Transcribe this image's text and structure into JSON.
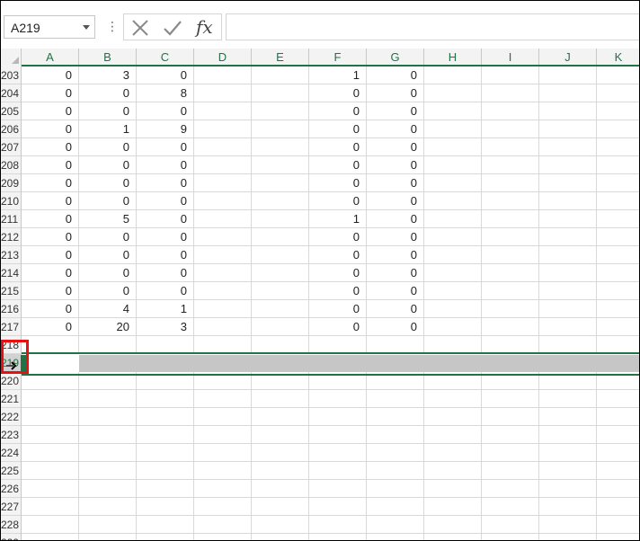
{
  "name_box": {
    "value": "A219"
  },
  "formula_bar": {
    "overflow_icon": "⋮",
    "cancel_icon": "cancel-x-icon",
    "enter_icon": "checkmark-icon",
    "function_label": "fx",
    "value": ""
  },
  "columns": [
    "A",
    "B",
    "C",
    "D",
    "E",
    "F",
    "G",
    "H",
    "I",
    "J",
    "K"
  ],
  "rows": [
    {
      "num": "203",
      "cells": {
        "A": "0",
        "B": "3",
        "C": "0",
        "F": "1",
        "G": "0"
      }
    },
    {
      "num": "204",
      "cells": {
        "A": "0",
        "B": "0",
        "C": "8",
        "F": "0",
        "G": "0"
      }
    },
    {
      "num": "205",
      "cells": {
        "A": "0",
        "B": "0",
        "C": "0",
        "F": "0",
        "G": "0"
      }
    },
    {
      "num": "206",
      "cells": {
        "A": "0",
        "B": "1",
        "C": "9",
        "F": "0",
        "G": "0"
      }
    },
    {
      "num": "207",
      "cells": {
        "A": "0",
        "B": "0",
        "C": "0",
        "F": "0",
        "G": "0"
      }
    },
    {
      "num": "208",
      "cells": {
        "A": "0",
        "B": "0",
        "C": "0",
        "F": "0",
        "G": "0"
      }
    },
    {
      "num": "209",
      "cells": {
        "A": "0",
        "B": "0",
        "C": "0",
        "F": "0",
        "G": "0"
      }
    },
    {
      "num": "210",
      "cells": {
        "A": "0",
        "B": "0",
        "C": "0",
        "F": "0",
        "G": "0"
      }
    },
    {
      "num": "211",
      "cells": {
        "A": "0",
        "B": "5",
        "C": "0",
        "F": "1",
        "G": "0"
      }
    },
    {
      "num": "212",
      "cells": {
        "A": "0",
        "B": "0",
        "C": "0",
        "F": "0",
        "G": "0"
      }
    },
    {
      "num": "213",
      "cells": {
        "A": "0",
        "B": "0",
        "C": "0",
        "F": "0",
        "G": "0"
      }
    },
    {
      "num": "214",
      "cells": {
        "A": "0",
        "B": "0",
        "C": "0",
        "F": "0",
        "G": "0"
      }
    },
    {
      "num": "215",
      "cells": {
        "A": "0",
        "B": "0",
        "C": "0",
        "F": "0",
        "G": "0"
      }
    },
    {
      "num": "216",
      "cells": {
        "A": "0",
        "B": "4",
        "C": "1",
        "F": "0",
        "G": "0"
      }
    },
    {
      "num": "217",
      "cells": {
        "A": "0",
        "B": "20",
        "C": "3",
        "F": "0",
        "G": "0"
      }
    },
    {
      "num": "218",
      "cells": {}
    },
    {
      "num": "219",
      "cells": {},
      "selected": true
    },
    {
      "num": "220",
      "cells": {}
    },
    {
      "num": "221",
      "cells": {}
    },
    {
      "num": "222",
      "cells": {}
    },
    {
      "num": "223",
      "cells": {}
    },
    {
      "num": "224",
      "cells": {}
    },
    {
      "num": "225",
      "cells": {}
    },
    {
      "num": "226",
      "cells": {}
    },
    {
      "num": "227",
      "cells": {}
    },
    {
      "num": "228",
      "cells": {}
    },
    {
      "num": "229",
      "cells": {}
    }
  ],
  "colors": {
    "accent": "#217346",
    "highlight": "#e81010",
    "selected_row": "#c6c6c6"
  }
}
